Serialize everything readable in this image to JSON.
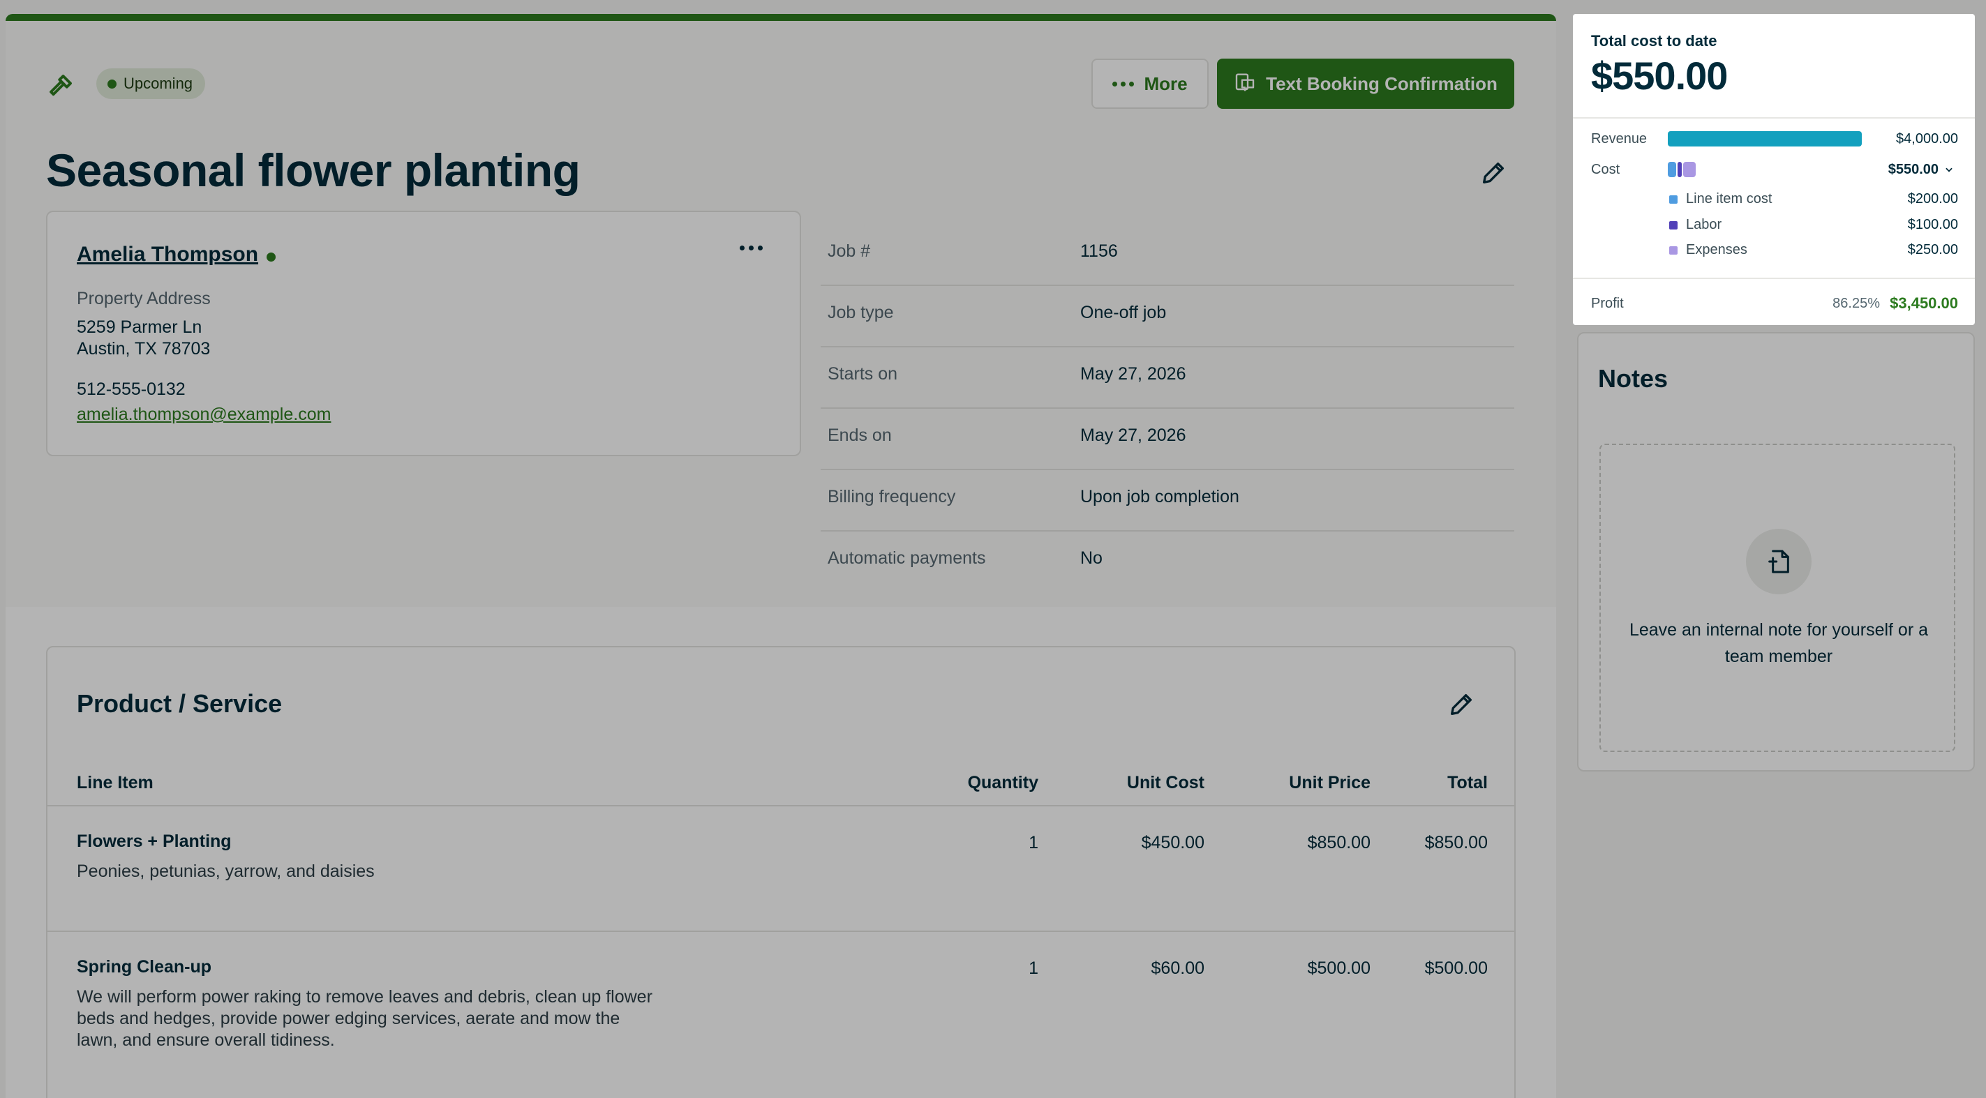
{
  "status": {
    "label": "Upcoming"
  },
  "actions": {
    "more_label": "More",
    "text_booking_label": "Text Booking Confirmation"
  },
  "job": {
    "title": "Seasonal flower planting"
  },
  "client": {
    "name": "Amelia Thompson",
    "property_label": "Property Address",
    "address_line1": "5259 Parmer Ln",
    "address_line2": "Austin, TX 78703",
    "phone": "512-555-0132",
    "email": "amelia.thompson@example.com"
  },
  "details": [
    {
      "label": "Job #",
      "value": "1156"
    },
    {
      "label": "Job type",
      "value": "One-off job"
    },
    {
      "label": "Starts on",
      "value": "May 27, 2026"
    },
    {
      "label": "Ends on",
      "value": "May 27, 2026"
    },
    {
      "label": "Billing frequency",
      "value": "Upon job completion"
    },
    {
      "label": "Automatic payments",
      "value": "No"
    }
  ],
  "products": {
    "title": "Product / Service",
    "columns": {
      "item": "Line Item",
      "quantity": "Quantity",
      "unit_cost": "Unit Cost",
      "unit_price": "Unit Price",
      "total": "Total"
    },
    "rows": [
      {
        "name": "Flowers + Planting",
        "description": "Peonies, petunias, yarrow, and daisies",
        "quantity": "1",
        "unit_cost": "$450.00",
        "unit_price": "$850.00",
        "total": "$850.00"
      },
      {
        "name": "Spring Clean-up",
        "description": "We will perform power raking to remove leaves and debris, clean up flower beds and hedges, provide power edging services, aerate and mow the lawn, and ensure overall tidiness.",
        "quantity": "1",
        "unit_cost": "$60.00",
        "unit_price": "$500.00",
        "total": "$500.00"
      }
    ]
  },
  "cost_summary": {
    "label": "Total cost to date",
    "total": "$550.00",
    "revenue_label": "Revenue",
    "revenue_value": "$4,000.00",
    "cost_label": "Cost",
    "cost_value": "$550.00",
    "breakdown": [
      {
        "label": "Line item cost",
        "value": "$200.00",
        "color": "#4f9ce0"
      },
      {
        "label": "Labor",
        "value": "$100.00",
        "color": "#5140b8"
      },
      {
        "label": "Expenses",
        "value": "$250.00",
        "color": "#a997e3"
      }
    ],
    "profit_label": "Profit",
    "profit_percent": "86.25%",
    "profit_value": "$3,450.00",
    "colors": {
      "revenue_bar": "#13a0be",
      "profit": "#2c7b1f"
    }
  },
  "notes": {
    "title": "Notes",
    "empty_text": "Leave an internal note for yourself or a team member"
  },
  "icons": [
    "hammer-icon",
    "ellipsis-icon",
    "text-message-icon",
    "pencil-icon",
    "chevron-down-icon",
    "add-note-icon"
  ],
  "colors": {
    "brand_green": "#2c7b1f",
    "text_dark": "#032b3a"
  }
}
